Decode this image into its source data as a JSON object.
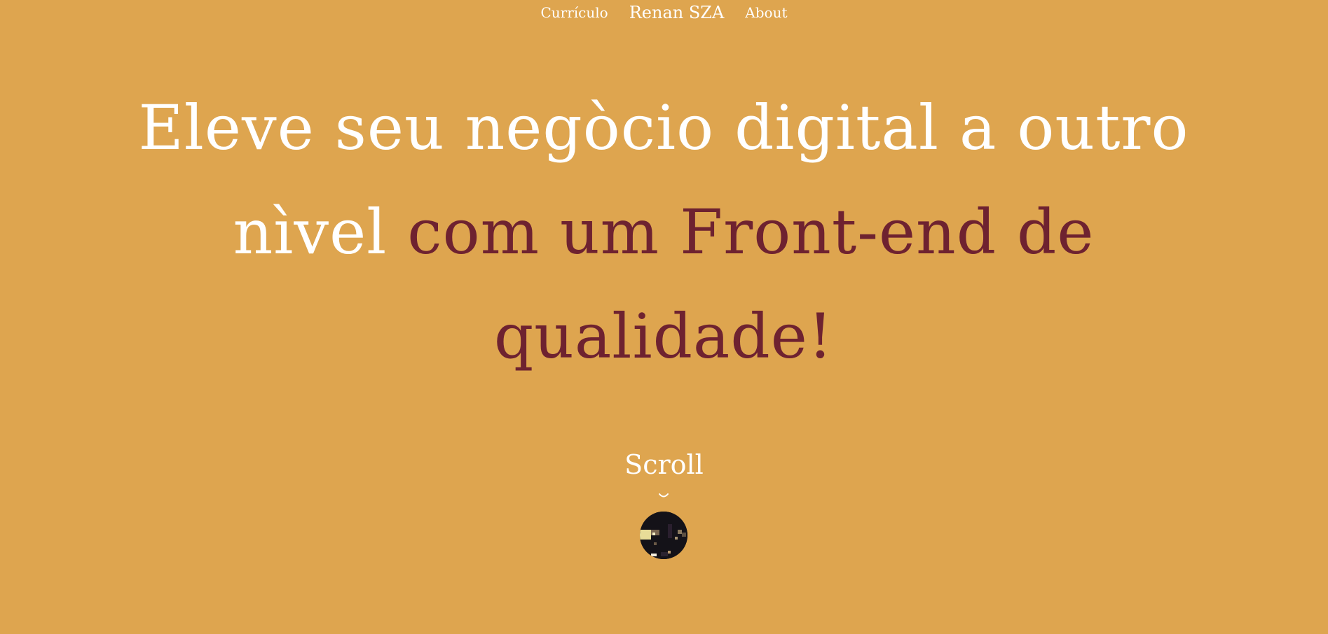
{
  "nav": {
    "curriculo_label": "Currículo",
    "brand_label": "Renan SZA",
    "about_label": "About"
  },
  "hero": {
    "headline_part1": "Eleve seu negòcio digital a outro nìvel ",
    "headline_part2": "com um Front-end de qualidade!"
  },
  "scroll": {
    "label": "Scroll",
    "icon": "chevron-down-icon"
  },
  "avatar": {
    "icon": "pixel-art-avatar"
  },
  "colors": {
    "background": "#dea54f",
    "text": "#ffffff",
    "accent": "#6e2230"
  }
}
